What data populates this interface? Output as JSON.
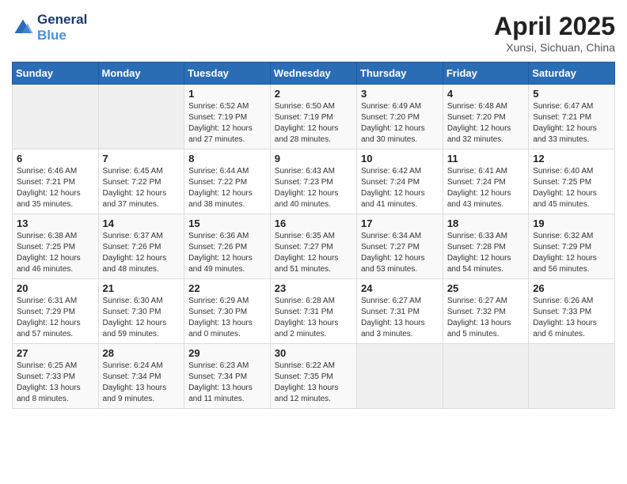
{
  "logo": {
    "line1": "General",
    "line2": "Blue"
  },
  "title": "April 2025",
  "location": "Xunsi, Sichuan, China",
  "days_of_week": [
    "Sunday",
    "Monday",
    "Tuesday",
    "Wednesday",
    "Thursday",
    "Friday",
    "Saturday"
  ],
  "weeks": [
    [
      {
        "day": "",
        "info": ""
      },
      {
        "day": "",
        "info": ""
      },
      {
        "day": "1",
        "info": "Sunrise: 6:52 AM\nSunset: 7:19 PM\nDaylight: 12 hours and 27 minutes."
      },
      {
        "day": "2",
        "info": "Sunrise: 6:50 AM\nSunset: 7:19 PM\nDaylight: 12 hours and 28 minutes."
      },
      {
        "day": "3",
        "info": "Sunrise: 6:49 AM\nSunset: 7:20 PM\nDaylight: 12 hours and 30 minutes."
      },
      {
        "day": "4",
        "info": "Sunrise: 6:48 AM\nSunset: 7:20 PM\nDaylight: 12 hours and 32 minutes."
      },
      {
        "day": "5",
        "info": "Sunrise: 6:47 AM\nSunset: 7:21 PM\nDaylight: 12 hours and 33 minutes."
      }
    ],
    [
      {
        "day": "6",
        "info": "Sunrise: 6:46 AM\nSunset: 7:21 PM\nDaylight: 12 hours and 35 minutes."
      },
      {
        "day": "7",
        "info": "Sunrise: 6:45 AM\nSunset: 7:22 PM\nDaylight: 12 hours and 37 minutes."
      },
      {
        "day": "8",
        "info": "Sunrise: 6:44 AM\nSunset: 7:22 PM\nDaylight: 12 hours and 38 minutes."
      },
      {
        "day": "9",
        "info": "Sunrise: 6:43 AM\nSunset: 7:23 PM\nDaylight: 12 hours and 40 minutes."
      },
      {
        "day": "10",
        "info": "Sunrise: 6:42 AM\nSunset: 7:24 PM\nDaylight: 12 hours and 41 minutes."
      },
      {
        "day": "11",
        "info": "Sunrise: 6:41 AM\nSunset: 7:24 PM\nDaylight: 12 hours and 43 minutes."
      },
      {
        "day": "12",
        "info": "Sunrise: 6:40 AM\nSunset: 7:25 PM\nDaylight: 12 hours and 45 minutes."
      }
    ],
    [
      {
        "day": "13",
        "info": "Sunrise: 6:38 AM\nSunset: 7:25 PM\nDaylight: 12 hours and 46 minutes."
      },
      {
        "day": "14",
        "info": "Sunrise: 6:37 AM\nSunset: 7:26 PM\nDaylight: 12 hours and 48 minutes."
      },
      {
        "day": "15",
        "info": "Sunrise: 6:36 AM\nSunset: 7:26 PM\nDaylight: 12 hours and 49 minutes."
      },
      {
        "day": "16",
        "info": "Sunrise: 6:35 AM\nSunset: 7:27 PM\nDaylight: 12 hours and 51 minutes."
      },
      {
        "day": "17",
        "info": "Sunrise: 6:34 AM\nSunset: 7:27 PM\nDaylight: 12 hours and 53 minutes."
      },
      {
        "day": "18",
        "info": "Sunrise: 6:33 AM\nSunset: 7:28 PM\nDaylight: 12 hours and 54 minutes."
      },
      {
        "day": "19",
        "info": "Sunrise: 6:32 AM\nSunset: 7:29 PM\nDaylight: 12 hours and 56 minutes."
      }
    ],
    [
      {
        "day": "20",
        "info": "Sunrise: 6:31 AM\nSunset: 7:29 PM\nDaylight: 12 hours and 57 minutes."
      },
      {
        "day": "21",
        "info": "Sunrise: 6:30 AM\nSunset: 7:30 PM\nDaylight: 12 hours and 59 minutes."
      },
      {
        "day": "22",
        "info": "Sunrise: 6:29 AM\nSunset: 7:30 PM\nDaylight: 13 hours and 0 minutes."
      },
      {
        "day": "23",
        "info": "Sunrise: 6:28 AM\nSunset: 7:31 PM\nDaylight: 13 hours and 2 minutes."
      },
      {
        "day": "24",
        "info": "Sunrise: 6:27 AM\nSunset: 7:31 PM\nDaylight: 13 hours and 3 minutes."
      },
      {
        "day": "25",
        "info": "Sunrise: 6:27 AM\nSunset: 7:32 PM\nDaylight: 13 hours and 5 minutes."
      },
      {
        "day": "26",
        "info": "Sunrise: 6:26 AM\nSunset: 7:33 PM\nDaylight: 13 hours and 6 minutes."
      }
    ],
    [
      {
        "day": "27",
        "info": "Sunrise: 6:25 AM\nSunset: 7:33 PM\nDaylight: 13 hours and 8 minutes."
      },
      {
        "day": "28",
        "info": "Sunrise: 6:24 AM\nSunset: 7:34 PM\nDaylight: 13 hours and 9 minutes."
      },
      {
        "day": "29",
        "info": "Sunrise: 6:23 AM\nSunset: 7:34 PM\nDaylight: 13 hours and 11 minutes."
      },
      {
        "day": "30",
        "info": "Sunrise: 6:22 AM\nSunset: 7:35 PM\nDaylight: 13 hours and 12 minutes."
      },
      {
        "day": "",
        "info": ""
      },
      {
        "day": "",
        "info": ""
      },
      {
        "day": "",
        "info": ""
      }
    ]
  ]
}
